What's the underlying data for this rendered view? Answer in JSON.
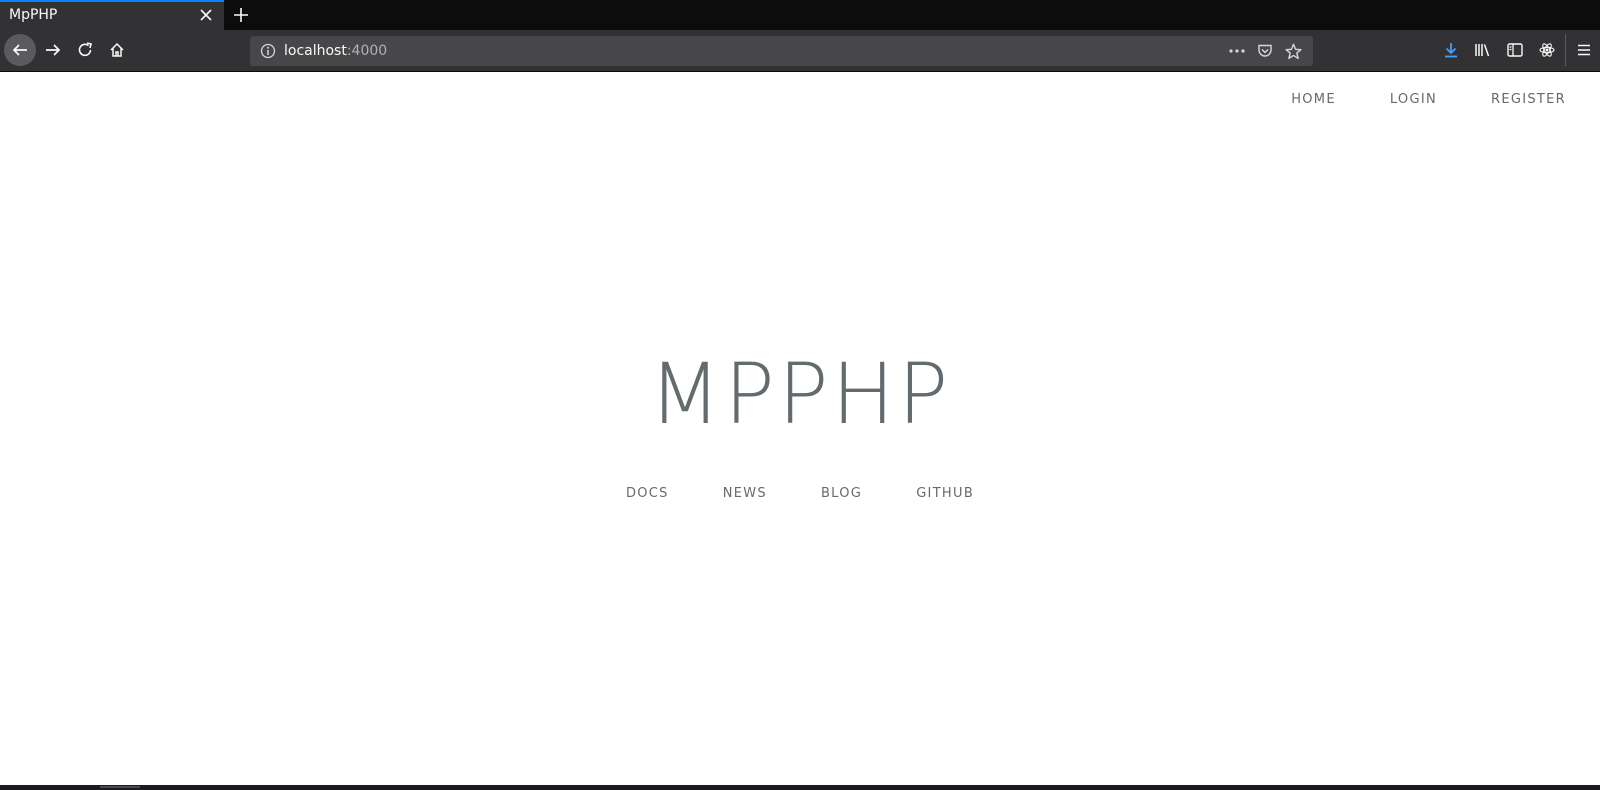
{
  "browser": {
    "tab": {
      "title": "MpPHP"
    },
    "address_bar": {
      "host": "localhost",
      "port": ":4000"
    },
    "icons": {
      "tab_close": "close-icon",
      "new_tab": "plus-icon",
      "back": "arrow-left-icon",
      "forward": "arrow-right-icon",
      "reload": "reload-icon",
      "home": "home-icon",
      "site_info": "info-icon",
      "page_actions": "more-icon",
      "pocket": "pocket-icon",
      "bookmark": "star-icon",
      "downloads": "download-icon",
      "library": "library-icon",
      "sidebar": "sidebar-icon",
      "react_devtools": "react-icon",
      "menu": "hamburger-icon"
    },
    "colors": {
      "accent": "#0a84ff",
      "chrome": "#323234",
      "tabstrip": "#0c0c0d"
    }
  },
  "page": {
    "nav": {
      "home": "Home",
      "login": "Login",
      "register": "Register"
    },
    "title": "MPPHP",
    "links": {
      "docs": "Docs",
      "news": "News",
      "blog": "Blog",
      "github": "GitHub"
    },
    "colors": {
      "text": "#636b6f",
      "background": "#ffffff"
    }
  }
}
